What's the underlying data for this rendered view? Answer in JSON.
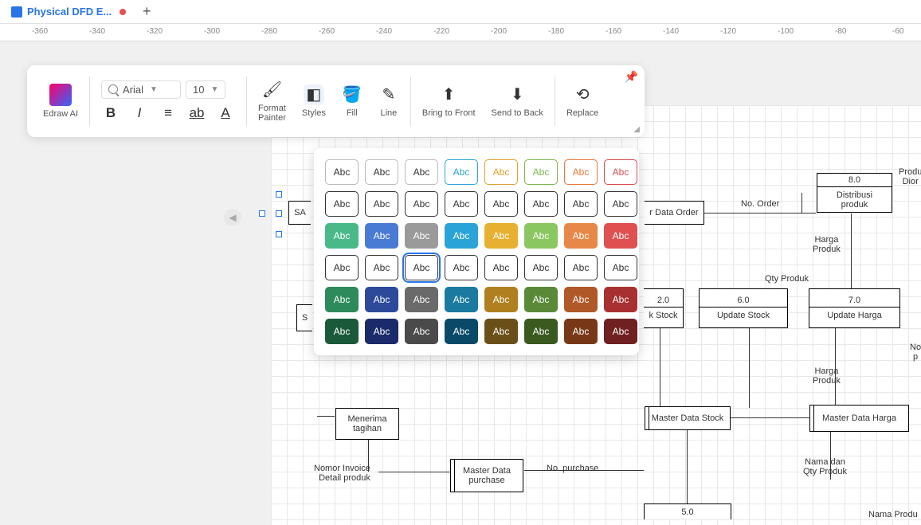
{
  "tab": {
    "title": "Physical DFD E..."
  },
  "ruler": [
    "-360",
    "-340",
    "-320",
    "-300",
    "-280",
    "-260",
    "-240",
    "-220",
    "-200",
    "-180",
    "-160",
    "-140",
    "-120",
    "-100",
    "-80",
    "-60"
  ],
  "toolbar": {
    "ai": "Edraw AI",
    "font": "Arial",
    "size": "10",
    "format_painter": "Format\nPainter",
    "styles": "Styles",
    "fill": "Fill",
    "line": "Line",
    "bring_front": "Bring to Front",
    "send_back": "Send to Back",
    "replace": "Replace"
  },
  "palette": {
    "label": "Abc",
    "rows": [
      [
        {
          "bg": "#ffffff",
          "fg": "#333",
          "bd": "#bbb"
        },
        {
          "bg": "#ffffff",
          "fg": "#333",
          "bd": "#bbb"
        },
        {
          "bg": "#ffffff",
          "fg": "#333",
          "bd": "#bbb"
        },
        {
          "bg": "#ffffff",
          "fg": "#2aa3d8",
          "bd": "#2aa3d8"
        },
        {
          "bg": "#ffffff",
          "fg": "#e0a030",
          "bd": "#e0a030"
        },
        {
          "bg": "#ffffff",
          "fg": "#7ab84d",
          "bd": "#7ab84d"
        },
        {
          "bg": "#ffffff",
          "fg": "#e87838",
          "bd": "#e87838"
        },
        {
          "bg": "#ffffff",
          "fg": "#d84a4a",
          "bd": "#d84a4a"
        }
      ],
      [
        {
          "bg": "#ffffff",
          "fg": "#333",
          "bd": "#333"
        },
        {
          "bg": "#ffffff",
          "fg": "#333",
          "bd": "#333"
        },
        {
          "bg": "#ffffff",
          "fg": "#333",
          "bd": "#333"
        },
        {
          "bg": "#ffffff",
          "fg": "#333",
          "bd": "#333"
        },
        {
          "bg": "#ffffff",
          "fg": "#333",
          "bd": "#333"
        },
        {
          "bg": "#ffffff",
          "fg": "#333",
          "bd": "#333"
        },
        {
          "bg": "#ffffff",
          "fg": "#333",
          "bd": "#333"
        },
        {
          "bg": "#ffffff",
          "fg": "#333",
          "bd": "#333"
        }
      ],
      [
        {
          "bg": "#4ab98a",
          "fg": "#fff",
          "bd": "#4ab98a"
        },
        {
          "bg": "#4a7bd4",
          "fg": "#fff",
          "bd": "#4a7bd4"
        },
        {
          "bg": "#9a9a9a",
          "fg": "#fff",
          "bd": "#9a9a9a"
        },
        {
          "bg": "#2aa3d8",
          "fg": "#fff",
          "bd": "#2aa3d8"
        },
        {
          "bg": "#e8b030",
          "fg": "#fff",
          "bd": "#e8b030"
        },
        {
          "bg": "#8ac760",
          "fg": "#fff",
          "bd": "#8ac760"
        },
        {
          "bg": "#e88848",
          "fg": "#fff",
          "bd": "#e88848"
        },
        {
          "bg": "#e05050",
          "fg": "#fff",
          "bd": "#e05050"
        }
      ],
      [
        {
          "bg": "#ffffff",
          "fg": "#333",
          "bd": "#333"
        },
        {
          "bg": "#ffffff",
          "fg": "#333",
          "bd": "#333"
        },
        {
          "bg": "#ffffff",
          "fg": "#333",
          "bd": "#333",
          "sel": true
        },
        {
          "bg": "#ffffff",
          "fg": "#333",
          "bd": "#333"
        },
        {
          "bg": "#ffffff",
          "fg": "#333",
          "bd": "#333"
        },
        {
          "bg": "#ffffff",
          "fg": "#333",
          "bd": "#333"
        },
        {
          "bg": "#ffffff",
          "fg": "#333",
          "bd": "#333"
        },
        {
          "bg": "#ffffff",
          "fg": "#333",
          "bd": "#333"
        }
      ],
      [
        {
          "bg": "#2d8a5a",
          "fg": "#fff",
          "bd": "#2d8a5a"
        },
        {
          "bg": "#2d4a9a",
          "fg": "#fff",
          "bd": "#2d4a9a"
        },
        {
          "bg": "#6a6a6a",
          "fg": "#fff",
          "bd": "#6a6a6a"
        },
        {
          "bg": "#1a7aa0",
          "fg": "#fff",
          "bd": "#1a7aa0"
        },
        {
          "bg": "#b08020",
          "fg": "#fff",
          "bd": "#b08020"
        },
        {
          "bg": "#5a8a38",
          "fg": "#fff",
          "bd": "#5a8a38"
        },
        {
          "bg": "#b05828",
          "fg": "#fff",
          "bd": "#b05828"
        },
        {
          "bg": "#a83030",
          "fg": "#fff",
          "bd": "#a83030"
        }
      ],
      [
        {
          "bg": "#1a5a3a",
          "fg": "#fff",
          "bd": "#1a5a3a"
        },
        {
          "bg": "#1a2a6a",
          "fg": "#fff",
          "bd": "#1a2a6a"
        },
        {
          "bg": "#4a4a4a",
          "fg": "#fff",
          "bd": "#4a4a4a"
        },
        {
          "bg": "#0a4a68",
          "fg": "#fff",
          "bd": "#0a4a68"
        },
        {
          "bg": "#6a5018",
          "fg": "#fff",
          "bd": "#6a5018"
        },
        {
          "bg": "#3a5a20",
          "fg": "#fff",
          "bd": "#3a5a20"
        },
        {
          "bg": "#783818",
          "fg": "#fff",
          "bd": "#783818"
        },
        {
          "bg": "#702020",
          "fg": "#fff",
          "bd": "#702020"
        }
      ]
    ]
  },
  "diagram": {
    "sales_partial": "SA",
    "s_partial": "S",
    "data_order": "r Data Order",
    "no_order": "No. Order",
    "n8_0": "8.0",
    "distribusi": "Distribusi\nproduk",
    "produk_dior": "Produ\nDior",
    "harga_produk": "Harga\nProduk",
    "qty_produk": "Qty Produk",
    "n2_0": "2.0",
    "k_stock": "k Stock",
    "n6_0": "6.0",
    "update_stock": "Update Stock",
    "n7_0": "7.0",
    "update_harga": "Update Harga",
    "no_p": "No\np",
    "harga_produk2": "Harga\nProduk",
    "menerima_tagihan": "Menerima\ntagihan",
    "master_stock": "Master Data Stock",
    "master_harga": "Master Data Harga",
    "nomor_invoice": "Nomor Invoice\nDetail produk",
    "master_purchase": "Master Data\npurchase",
    "no_purchase": "No. purchase",
    "nama_qty": "Nama dan\nQty Produk",
    "n5_0": "5.0",
    "nama_produ": "Nama Produ"
  }
}
